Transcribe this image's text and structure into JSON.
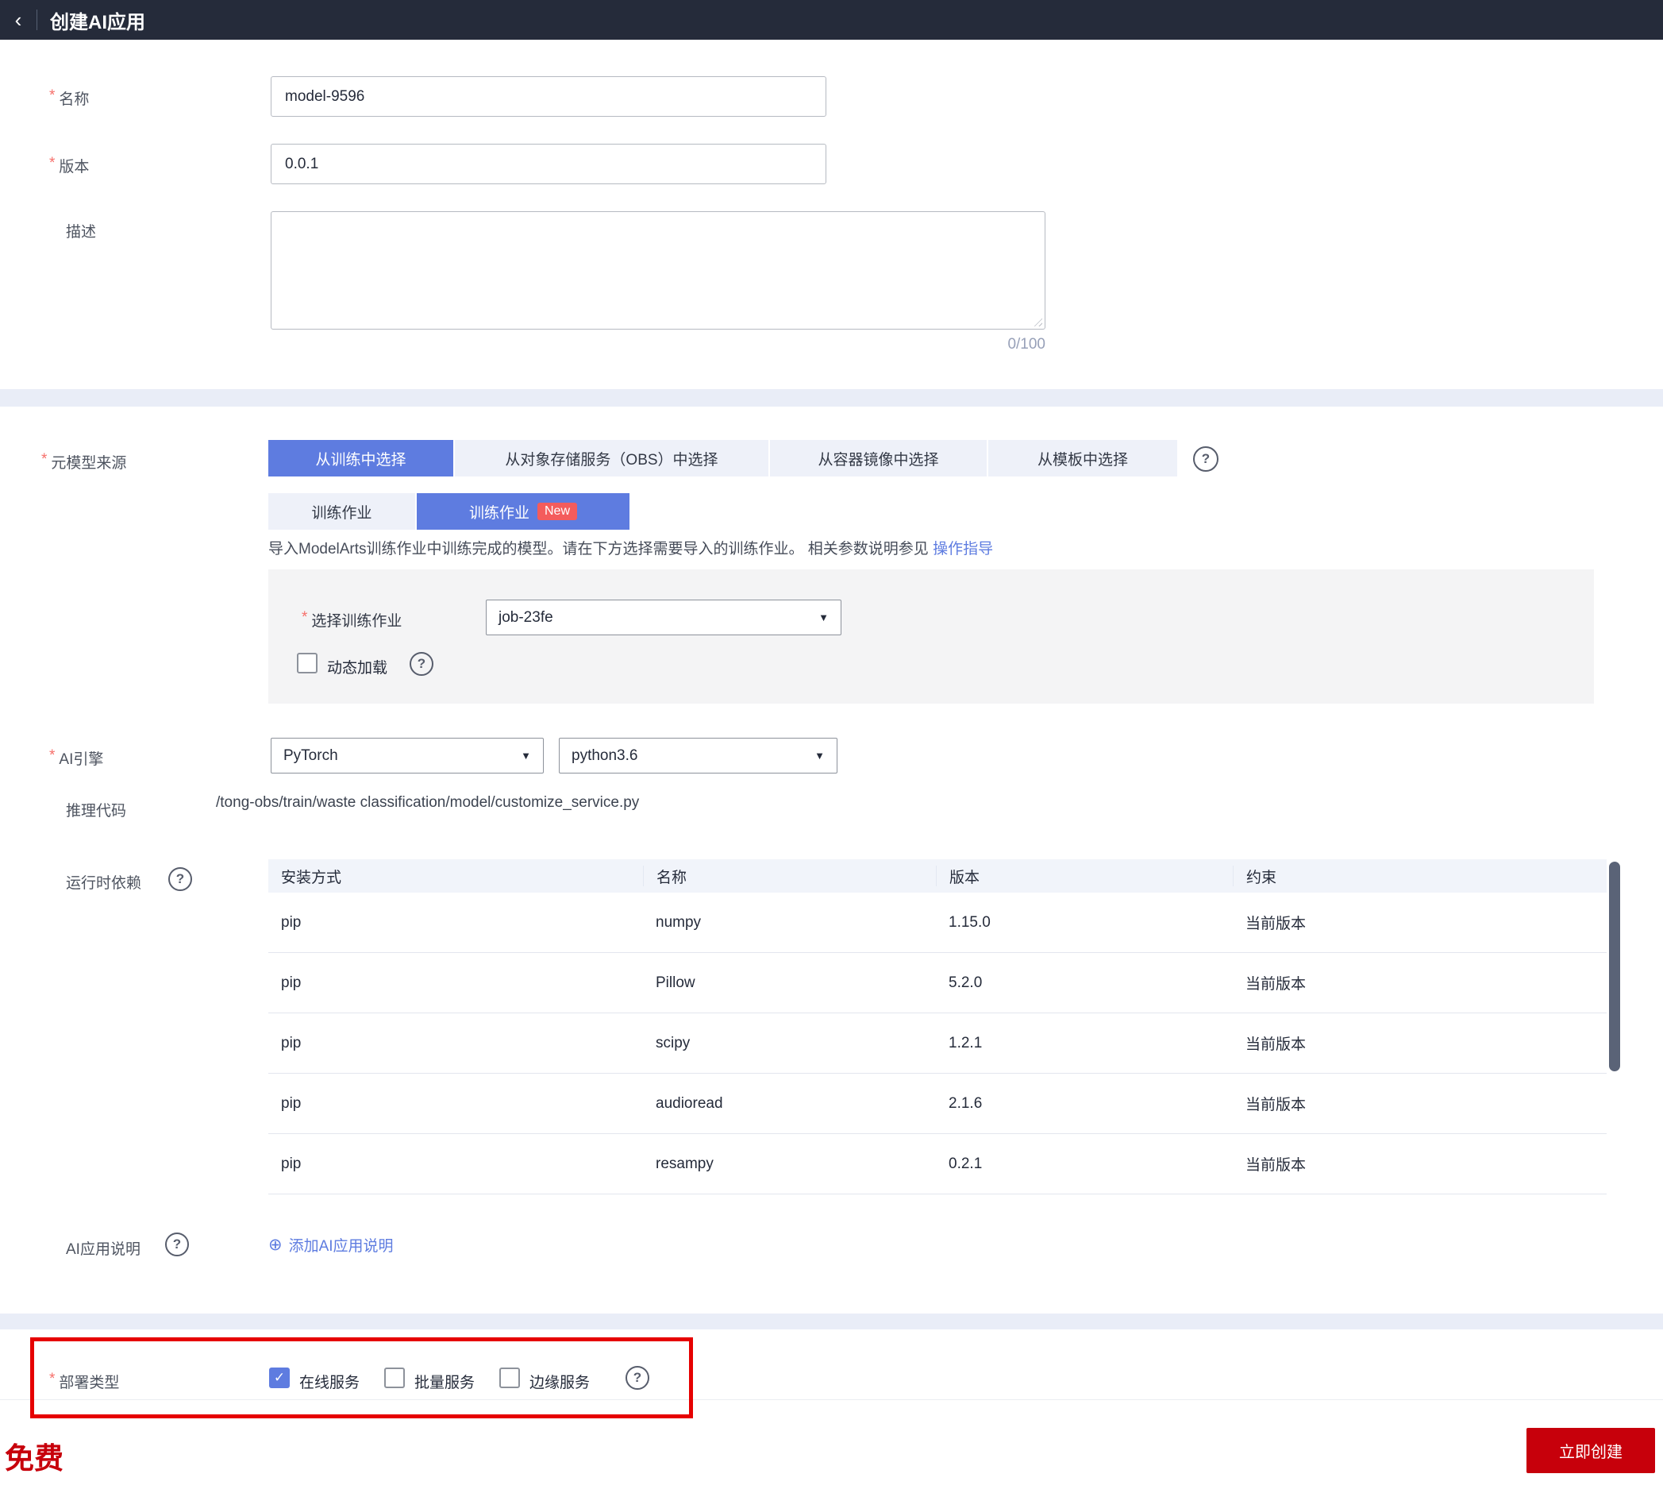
{
  "header": {
    "title": "创建AI应用"
  },
  "icons": {
    "back": "‹",
    "help": "?",
    "caret": "▼",
    "check": "✓",
    "add_circle": "⊕",
    "required_mark": "*"
  },
  "form": {
    "name": {
      "label": "名称",
      "value": "model-9596"
    },
    "version": {
      "label": "版本",
      "value": "0.0.1"
    },
    "description": {
      "label": "描述",
      "value": "",
      "counter": "0/100"
    },
    "meta_model_source": {
      "label": "元模型来源",
      "tabs": [
        {
          "label": "从训练中选择"
        },
        {
          "label": "从对象存储服务（OBS）中选择"
        },
        {
          "label": "从容器镜像中选择"
        },
        {
          "label": "从模板中选择"
        }
      ],
      "subtabs": [
        {
          "label": "训练作业"
        },
        {
          "label": "训练作业",
          "badge": "New"
        }
      ],
      "hint": "导入ModelArts训练作业中训练完成的模型。请在下方选择需要导入的训练作业。 相关参数说明参见",
      "hint_link": "操作指导",
      "job_select": {
        "label": "选择训练作业",
        "value": "job-23fe"
      },
      "dynamic_load": {
        "label": "动态加载",
        "checked": false
      }
    },
    "ai_engine": {
      "label": "AI引擎",
      "engine": "PyTorch",
      "runtime": "python3.6"
    },
    "inference_code": {
      "label": "推理代码",
      "value": "/tong-obs/train/waste classification/model/customize_service.py"
    },
    "runtime_deps": {
      "label": "运行时依赖",
      "table": {
        "headers": [
          "安装方式",
          "名称",
          "版本",
          "约束"
        ],
        "rows": [
          [
            "pip",
            "numpy",
            "1.15.0",
            "当前版本"
          ],
          [
            "pip",
            "Pillow",
            "5.2.0",
            "当前版本"
          ],
          [
            "pip",
            "scipy",
            "1.2.1",
            "当前版本"
          ],
          [
            "pip",
            "audioread",
            "2.1.6",
            "当前版本"
          ],
          [
            "pip",
            "resampy",
            "0.2.1",
            "当前版本"
          ]
        ]
      }
    },
    "app_description": {
      "label": "AI应用说明",
      "add_link": "添加AI应用说明"
    },
    "deploy_type": {
      "label": "部署类型",
      "options": [
        {
          "label": "在线服务",
          "checked": true
        },
        {
          "label": "批量服务",
          "checked": false
        },
        {
          "label": "边缘服务",
          "checked": false
        }
      ]
    }
  },
  "footer": {
    "free_label": "免费",
    "create_button": "立即创建"
  },
  "colors": {
    "header_bg": "#252b3a",
    "primary_blue": "#5e7ce0",
    "brand_red": "#c7000b",
    "badge_red": "#f45c5c",
    "highlight_red": "#e60000",
    "band_bg": "#e9edf7",
    "panel_bg": "#f4f4f5",
    "table_header_bg": "#f1f4fa"
  }
}
